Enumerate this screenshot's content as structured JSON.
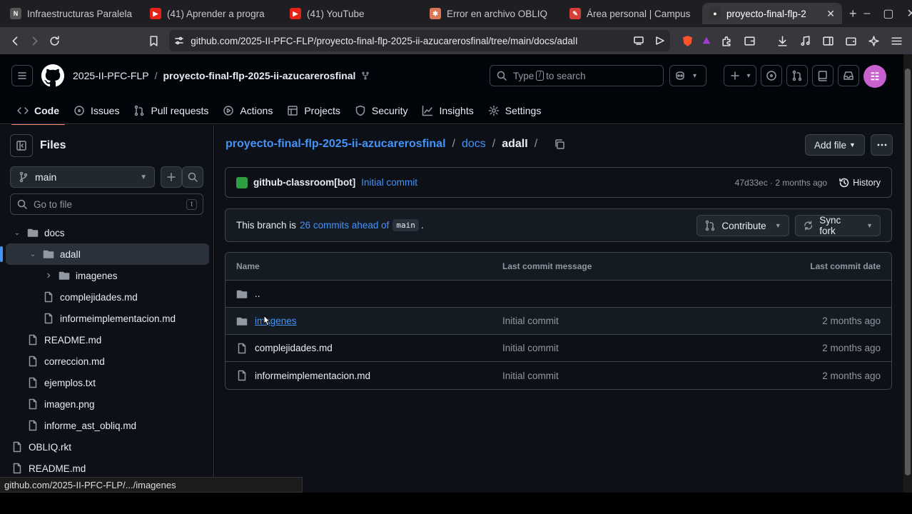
{
  "browser": {
    "tabs": [
      {
        "title": "Infraestructuras Paralela",
        "fav": "N",
        "favcolor": "#555"
      },
      {
        "title": "(41) Aprender a progra",
        "fav": "▶",
        "favcolor": "#e62117"
      },
      {
        "title": "(41) YouTube",
        "fav": "▶",
        "favcolor": "#e62117"
      },
      {
        "title": "Error en archivo OBLIQ",
        "fav": "✱",
        "favcolor": "#d97757"
      },
      {
        "title": "Área personal | Campus",
        "fav": "✎",
        "favcolor": "#d43f3a"
      },
      {
        "title": "proyecto-final-flp-2",
        "fav": "●",
        "favcolor": "#333"
      }
    ],
    "url": "github.com/2025-II-PFC-FLP/proyecto-final-flp-2025-ii-azucarerosfinal/tree/main/docs/adalI"
  },
  "header": {
    "org": "2025-II-PFC-FLP",
    "repo": "proyecto-final-flp-2025-ii-azucarerosfinal",
    "search_type": "Type",
    "search_key": "/",
    "search_rest": "to search"
  },
  "nav": [
    {
      "label": "Code",
      "icon": "code-icon"
    },
    {
      "label": "Issues",
      "icon": "issue-icon"
    },
    {
      "label": "Pull requests",
      "icon": "pull-request-icon"
    },
    {
      "label": "Actions",
      "icon": "play-icon"
    },
    {
      "label": "Projects",
      "icon": "table-icon"
    },
    {
      "label": "Security",
      "icon": "shield-icon"
    },
    {
      "label": "Insights",
      "icon": "graph-icon"
    },
    {
      "label": "Settings",
      "icon": "gear-icon"
    }
  ],
  "sidebar": {
    "title": "Files",
    "branch": "main",
    "goto_placeholder": "Go to file",
    "goto_key": "t",
    "tree": [
      {
        "label": "docs",
        "type": "folder",
        "level": 0,
        "open": true
      },
      {
        "label": "adalI",
        "type": "folder",
        "level": 1,
        "open": true,
        "selected": true
      },
      {
        "label": "imagenes",
        "type": "folder",
        "level": 2,
        "open": false
      },
      {
        "label": "complejidades.md",
        "type": "file",
        "level": 2
      },
      {
        "label": "informeimplementacion.md",
        "type": "file",
        "level": 2
      },
      {
        "label": "README.md",
        "type": "file",
        "level": 1
      },
      {
        "label": "correccion.md",
        "type": "file",
        "level": 1
      },
      {
        "label": "ejemplos.txt",
        "type": "file",
        "level": 1
      },
      {
        "label": "imagen.png",
        "type": "file",
        "level": 1
      },
      {
        "label": "informe_ast_obliq.md",
        "type": "file",
        "level": 1
      },
      {
        "label": "OBLIQ.rkt",
        "type": "file",
        "level": 0
      },
      {
        "label": "README.md",
        "type": "file",
        "level": 0
      }
    ]
  },
  "main": {
    "path_repo": "proyecto-final-flp-2025-ii-azucarerosfinal",
    "path_docs": "docs",
    "path_current": "adalI",
    "add_file": "Add file",
    "commit": {
      "author": "github-classroom[bot]",
      "message": "Initial commit",
      "meta": "47d33ec · 2 months ago",
      "history": "History"
    },
    "ahead": {
      "prefix": "This branch is",
      "link": "26 commits ahead of",
      "branch": "main",
      "suffix": ".",
      "contribute": "Contribute",
      "sync": "Sync fork"
    },
    "table": {
      "headers": [
        "Name",
        "Last commit message",
        "Last commit date"
      ],
      "rows": [
        {
          "name": "..",
          "type": "folder",
          "message": "",
          "date": ""
        },
        {
          "name": "imagenes",
          "type": "folder",
          "message": "Initial commit",
          "date": "2 months ago"
        },
        {
          "name": "complejidades.md",
          "type": "file",
          "message": "Initial commit",
          "date": "2 months ago"
        },
        {
          "name": "informeimplementacion.md",
          "type": "file",
          "message": "Initial commit",
          "date": "2 months ago"
        }
      ]
    }
  },
  "status_url": "github.com/2025-II-PFC-FLP/.../imagenes"
}
